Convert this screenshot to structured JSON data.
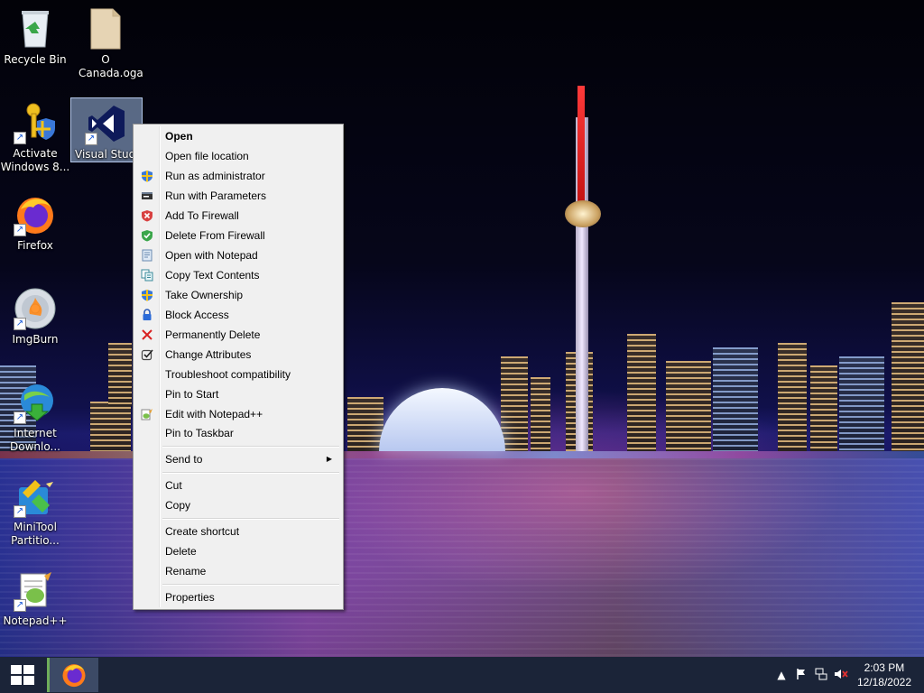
{
  "desktop": {
    "icons": [
      {
        "label": "Recycle Bin",
        "icon": "recycle-bin-icon"
      },
      {
        "label": "O Canada.oga",
        "icon": "audio-file-icon"
      },
      {
        "label": "Activate Windows 8...",
        "icon": "key-shield-icon"
      },
      {
        "label": "Visual Studio",
        "icon": "visual-studio-icon"
      },
      {
        "label": "Firefox",
        "icon": "firefox-icon"
      },
      {
        "label": "ImgBurn",
        "icon": "disc-icon"
      },
      {
        "label": "Internet Downlo...",
        "icon": "internet-download-manager-icon"
      },
      {
        "label": "MiniTool Partitio...",
        "icon": "minitool-icon"
      },
      {
        "label": "Notepad++",
        "icon": "notepadpp-icon"
      }
    ]
  },
  "context_menu": {
    "items": [
      {
        "label": "Open",
        "icon": ""
      },
      {
        "label": "Open file location",
        "icon": ""
      },
      {
        "label": "Run as administrator",
        "icon": "uac-shield-icon"
      },
      {
        "label": "Run with Parameters",
        "icon": "console-icon"
      },
      {
        "label": "Add To Firewall",
        "icon": "firewall-add-icon"
      },
      {
        "label": "Delete From Firewall",
        "icon": "firewall-delete-icon"
      },
      {
        "label": "Open with Notepad",
        "icon": "notepad-icon"
      },
      {
        "label": "Copy Text Contents",
        "icon": "copy-text-icon"
      },
      {
        "label": "Take Ownership",
        "icon": "shield-icon"
      },
      {
        "label": "Block Access",
        "icon": "lock-icon"
      },
      {
        "label": "Permanently Delete",
        "icon": "delete-x-icon"
      },
      {
        "label": "Change Attributes",
        "icon": "checkbox-icon"
      },
      {
        "label": "Troubleshoot compatibility",
        "icon": ""
      },
      {
        "label": "Pin to Start",
        "icon": ""
      },
      {
        "label": "Edit with Notepad++",
        "icon": "notepadpp-icon"
      },
      {
        "label": "Pin to Taskbar",
        "icon": ""
      },
      {
        "label": "Send to",
        "icon": ""
      },
      {
        "label": "Cut",
        "icon": ""
      },
      {
        "label": "Copy",
        "icon": ""
      },
      {
        "label": "Create shortcut",
        "icon": ""
      },
      {
        "label": "Delete",
        "icon": ""
      },
      {
        "label": "Rename",
        "icon": ""
      },
      {
        "label": "Properties",
        "icon": ""
      }
    ]
  },
  "taskbar": {
    "pinned": [
      {
        "icon": "firefox-icon"
      }
    ],
    "tray": {
      "time": "2:03 PM",
      "date": "12/18/2022",
      "icons": [
        "show-hidden-icons-chevron",
        "action-center-flag-icon",
        "network-icon",
        "volume-muted-icon"
      ]
    }
  }
}
